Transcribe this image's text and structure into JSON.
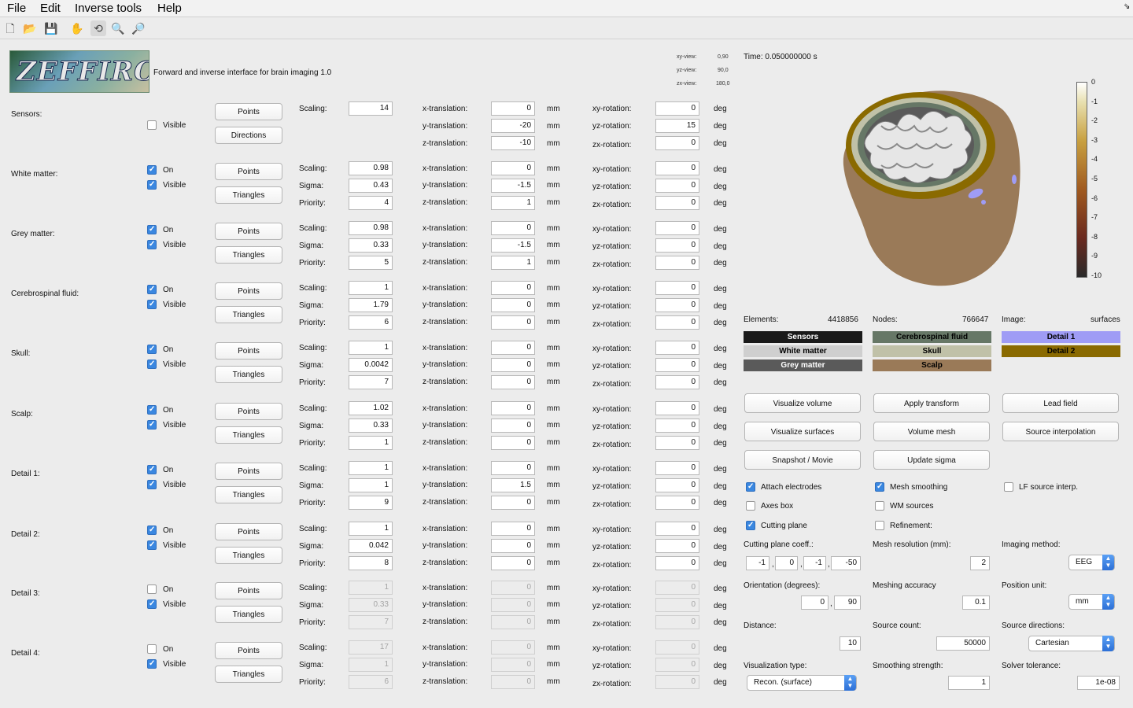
{
  "menu": [
    "File",
    "Edit",
    "Inverse tools",
    "Help"
  ],
  "toolbar_icons": [
    "new-file-icon",
    "open-folder-icon",
    "save-icon",
    "pan-hand-icon",
    "rotate-icon",
    "zoom-in-icon",
    "zoom-out-icon"
  ],
  "header": {
    "logo_text": "ZEFFIRO",
    "subtitle": "Forward and inverse interface for brain imaging 1.0",
    "views": [
      {
        "label": "xy-view:",
        "value": "0,90"
      },
      {
        "label": "yz-view:",
        "value": "90,0"
      },
      {
        "label": "zx-view:",
        "value": "180,0"
      }
    ],
    "time": "Time: 0.050000000 s"
  },
  "labels": {
    "on": "On",
    "visible": "Visible",
    "points": "Points",
    "directions": "Directions",
    "triangles": "Triangles",
    "scaling": "Scaling:",
    "sigma": "Sigma:",
    "priority": "Priority:",
    "xt": "x-translation:",
    "yt": "y-translation:",
    "zt": "z-translation:",
    "xyr": "xy-rotation:",
    "yzr": "yz-rotation:",
    "zxr": "zx-rotation:",
    "mm": "mm",
    "deg": "deg"
  },
  "sensors": {
    "name": "Sensors:",
    "visible": false,
    "scaling": "14",
    "xt": "0",
    "yt": "-20",
    "zt": "-10",
    "xyr": "0",
    "yzr": "15",
    "zxr": "0"
  },
  "compartments": [
    {
      "name": "White matter:",
      "on": true,
      "visible": true,
      "disabled": false,
      "scaling": "0.98",
      "sigma": "0.43",
      "priority": "4",
      "xt": "0",
      "yt": "-1.5",
      "zt": "1",
      "xyr": "0",
      "yzr": "0",
      "zxr": "0"
    },
    {
      "name": "Grey matter:",
      "on": true,
      "visible": true,
      "disabled": false,
      "scaling": "0.98",
      "sigma": "0.33",
      "priority": "5",
      "xt": "0",
      "yt": "-1.5",
      "zt": "1",
      "xyr": "0",
      "yzr": "0",
      "zxr": "0"
    },
    {
      "name": "Cerebrospinal fluid:",
      "on": true,
      "visible": true,
      "disabled": false,
      "scaling": "1",
      "sigma": "1.79",
      "priority": "6",
      "xt": "0",
      "yt": "0",
      "zt": "0",
      "xyr": "0",
      "yzr": "0",
      "zxr": "0"
    },
    {
      "name": "Skull:",
      "on": true,
      "visible": true,
      "disabled": false,
      "scaling": "1",
      "sigma": "0.0042",
      "priority": "7",
      "xt": "0",
      "yt": "0",
      "zt": "0",
      "xyr": "0",
      "yzr": "0",
      "zxr": "0"
    },
    {
      "name": "Scalp:",
      "on": true,
      "visible": true,
      "disabled": false,
      "scaling": "1.02",
      "sigma": "0.33",
      "priority": "1",
      "xt": "0",
      "yt": "0",
      "zt": "0",
      "xyr": "0",
      "yzr": "0",
      "zxr": "0"
    },
    {
      "name": "Detail 1:",
      "on": true,
      "visible": true,
      "disabled": false,
      "scaling": "1",
      "sigma": "1",
      "priority": "9",
      "xt": "0",
      "yt": "1.5",
      "zt": "0",
      "xyr": "0",
      "yzr": "0",
      "zxr": "0"
    },
    {
      "name": "Detail 2:",
      "on": true,
      "visible": true,
      "disabled": false,
      "scaling": "1",
      "sigma": "0.042",
      "priority": "8",
      "xt": "0",
      "yt": "0",
      "zt": "0",
      "xyr": "0",
      "yzr": "0",
      "zxr": "0"
    },
    {
      "name": "Detail 3:",
      "on": false,
      "visible": true,
      "disabled": true,
      "scaling": "1",
      "sigma": "0.33",
      "priority": "7",
      "xt": "0",
      "yt": "0",
      "zt": "0",
      "xyr": "0",
      "yzr": "0",
      "zxr": "0"
    },
    {
      "name": "Detail 4:",
      "on": false,
      "visible": true,
      "disabled": true,
      "scaling": "17",
      "sigma": "1",
      "priority": "6",
      "xt": "0",
      "yt": "0",
      "zt": "0",
      "xyr": "0",
      "yzr": "0",
      "zxr": "0"
    }
  ],
  "colorbar": {
    "ticks": [
      "0",
      "-1",
      "-2",
      "-3",
      "-4",
      "-5",
      "-6",
      "-7",
      "-8",
      "-9",
      "-10"
    ]
  },
  "stats": {
    "elements_label": "Elements:",
    "elements": "4418856",
    "nodes_label": "Nodes:",
    "nodes": "766647",
    "image_label": "Image:",
    "image": "surfaces"
  },
  "legend": [
    {
      "label": "Sensors",
      "bg": "#1a1a1a",
      "fg": "#ffffff"
    },
    {
      "label": "White matter",
      "bg": "#cfcfcf",
      "fg": "#000000"
    },
    {
      "label": "Grey matter",
      "bg": "#5a5a5a",
      "fg": "#ffffff"
    },
    {
      "label": "Cerebrospinal fluid",
      "bg": "#667766",
      "fg": "#000000"
    },
    {
      "label": "Skull",
      "bg": "#c0c1a8",
      "fg": "#000000"
    },
    {
      "label": "Scalp",
      "bg": "#9a7a58",
      "fg": "#000000"
    },
    {
      "label": "Detail 1",
      "bg": "#9f9cf5",
      "fg": "#000000"
    },
    {
      "label": "Detail 2",
      "bg": "#8a6a00",
      "fg": "#000000"
    }
  ],
  "actions": [
    "Visualize volume",
    "Apply transform",
    "Lead field",
    "Visualize surfaces",
    "Volume mesh",
    "Source interpolation",
    "Snapshot / Movie",
    "Update sigma"
  ],
  "options": [
    {
      "label": "Attach electrodes",
      "checked": true
    },
    {
      "label": "Mesh smoothing",
      "checked": true
    },
    {
      "label": "LF source interp.",
      "checked": false
    },
    {
      "label": "Axes box",
      "checked": false
    },
    {
      "label": "WM sources",
      "checked": false
    },
    {
      "label": "Cutting plane",
      "checked": true
    },
    {
      "label": "Refinement:",
      "checked": false
    }
  ],
  "settings": {
    "cutting_label": "Cutting plane coeff.:",
    "cutting": [
      "-1",
      "0",
      "-1",
      "-50"
    ],
    "mesh_res_label": "Mesh resolution (mm):",
    "mesh_res": "2",
    "imaging_label": "Imaging method:",
    "imaging": "EEG",
    "orientation_label": "Orientation (degrees):",
    "orientation": [
      "0",
      "90"
    ],
    "meshing_acc_label": "Meshing accuracy",
    "meshing_acc": "0.1",
    "pos_unit_label": "Position unit:",
    "pos_unit": "mm",
    "distance_label": "Distance:",
    "distance": "10",
    "source_count_label": "Source count:",
    "source_count": "50000",
    "source_dir_label": "Source directions:",
    "source_dir": "Cartesian",
    "vis_type_label": "Visualization type:",
    "vis_type": "Recon. (surface)",
    "smooth_label": "Smoothing strength:",
    "smooth": "1",
    "solver_label": "Solver tolerance:",
    "solver": "1e-08"
  }
}
